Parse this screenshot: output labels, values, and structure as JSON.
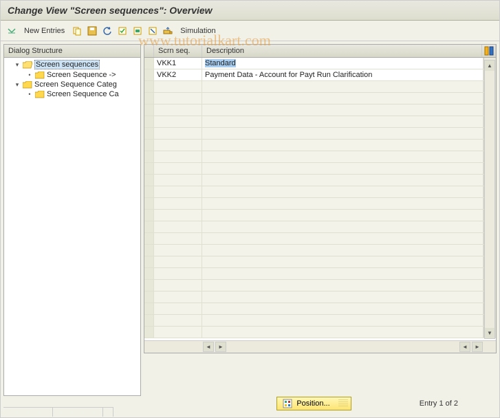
{
  "title": "Change View \"Screen sequences\": Overview",
  "watermark": "www.tutorialkart.com",
  "toolbar": {
    "new_entries": "New Entries",
    "simulation": "Simulation"
  },
  "tree": {
    "header": "Dialog Structure",
    "nodes": [
      {
        "label": "Screen sequences",
        "open": true,
        "level": 1,
        "selected": true
      },
      {
        "label": "Screen Sequence ->",
        "open": false,
        "level": 2,
        "selected": false
      },
      {
        "label": "Screen Sequence Categ",
        "open": true,
        "level": 1,
        "selected": false
      },
      {
        "label": "Screen Sequence Ca",
        "open": false,
        "level": 2,
        "selected": false
      }
    ]
  },
  "table": {
    "columns": {
      "seq": "Scrn seq.",
      "desc": "Description"
    },
    "rows": [
      {
        "seq": "VKK1",
        "desc": "Standard",
        "selected": true
      },
      {
        "seq": "VKK2",
        "desc": "Payment Data - Account for Payt Run Clarification",
        "selected": false
      }
    ]
  },
  "footer": {
    "position": "Position...",
    "entry": "Entry 1 of 2"
  }
}
